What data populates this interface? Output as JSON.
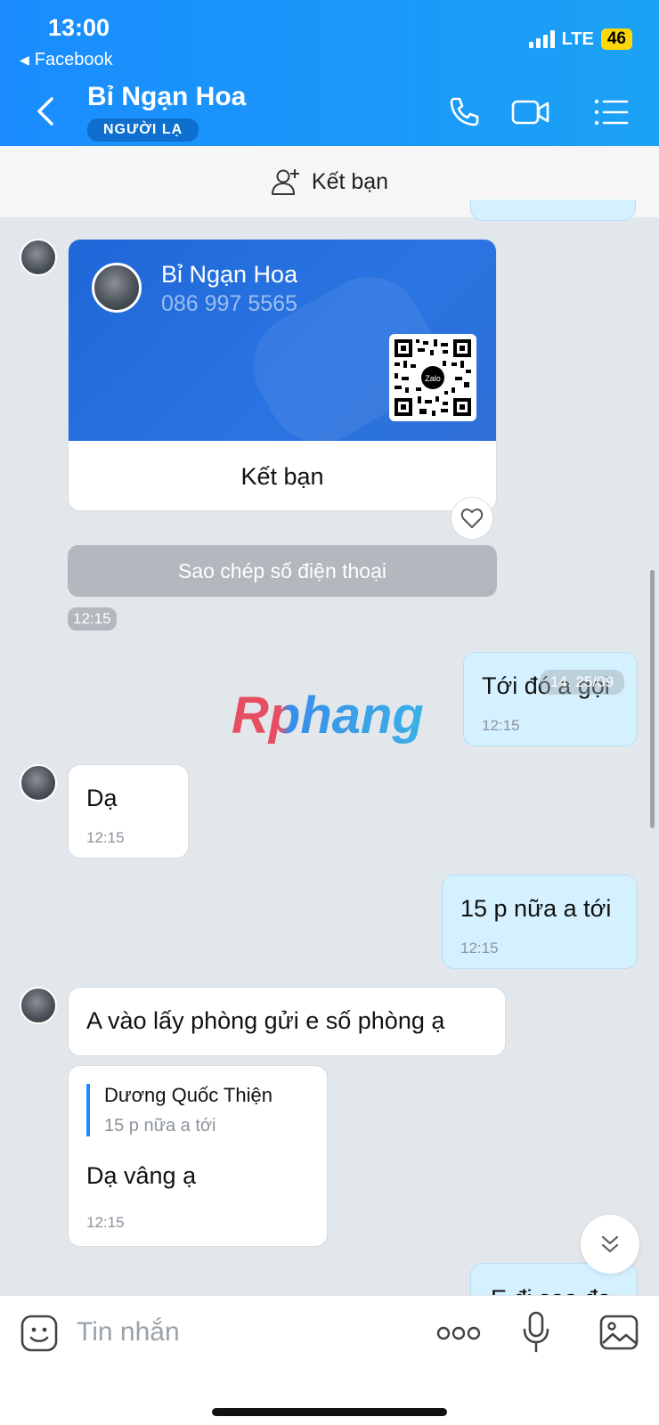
{
  "status_bar": {
    "time": "13:00",
    "back_app": "Facebook",
    "network": "LTE",
    "battery": "46"
  },
  "header": {
    "contact_name": "Bỉ Ngạn Hoa",
    "badge": "NGƯỜI LẠ",
    "icons": [
      "back-icon",
      "phone-icon",
      "video-call-icon",
      "menu-icon"
    ],
    "color": "#1a8cff"
  },
  "add_friend_bar": {
    "label": "Kết bạn"
  },
  "contact_card": {
    "name": "Bỉ Ngạn Hoa",
    "phone": "086 997 5565",
    "qr_brand": "Zalo",
    "action": "Kết bạn"
  },
  "copy_phone_button": "Sao chép số điện thoại",
  "card_time": "12:15",
  "watermark": "Rphang",
  "date_overlay": "14. 25/09",
  "messages": [
    {
      "id": "m1",
      "direction": "out",
      "text": "Tới đó a gọi",
      "time": "12:15"
    },
    {
      "id": "m2",
      "direction": "in",
      "text": "Dạ",
      "time": "12:15"
    },
    {
      "id": "m3",
      "direction": "out",
      "text": "15 p nữa a tới",
      "time": "12:15"
    },
    {
      "id": "m4",
      "direction": "in",
      "text": "A vào lấy phòng gửi e số phòng ạ"
    },
    {
      "id": "m5",
      "direction": "in",
      "quote_name": "Dương Quốc Thiện",
      "quote_text": "15 p nữa a tới",
      "text": "Dạ vâng ạ",
      "time": "12:15"
    },
    {
      "id": "m6",
      "direction": "out",
      "text": "E đi sao đạ"
    }
  ],
  "composer": {
    "placeholder": "Tin nhắn",
    "more_label": "ooo"
  }
}
